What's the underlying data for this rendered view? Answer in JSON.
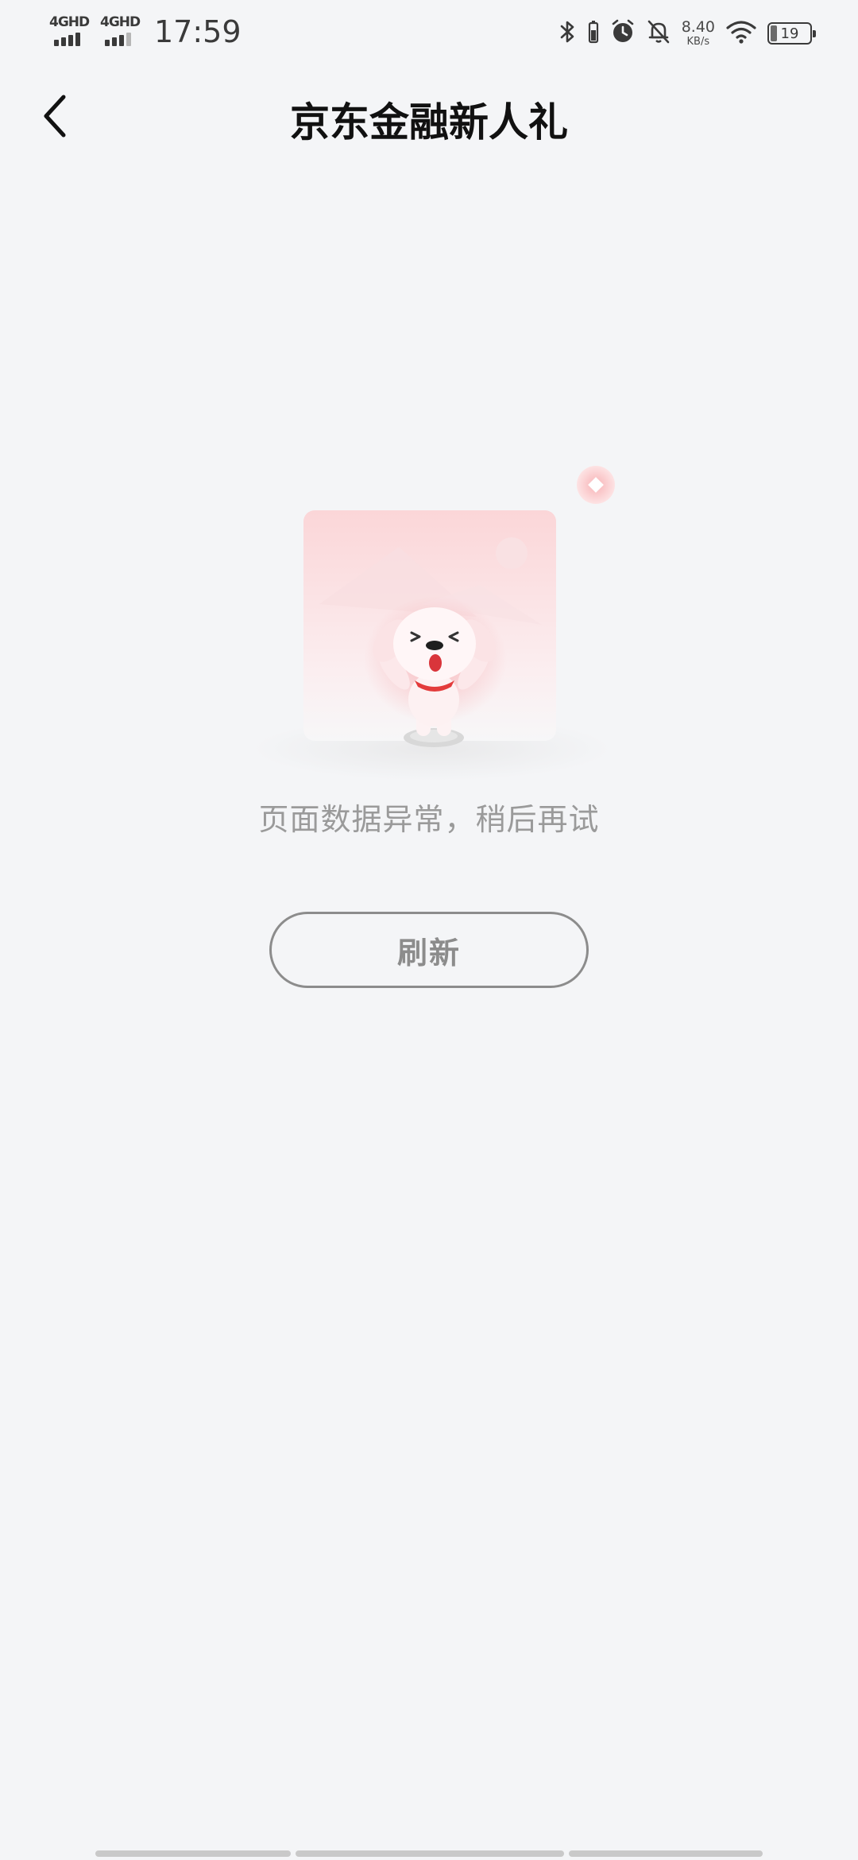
{
  "status_bar": {
    "network_1": "4GHD",
    "network_2": "4GHD",
    "time": "17:59",
    "speed_value": "8.40",
    "speed_unit": "KB/s",
    "battery_level": "19",
    "icons": [
      "bluetooth-icon",
      "battery-saver-icon",
      "alarm-icon",
      "mute-bell-icon",
      "wifi-icon"
    ]
  },
  "header": {
    "back_icon": "chevron-left-icon",
    "title": "京东金融新人礼"
  },
  "error_state": {
    "illustration": "jd-dog-mascot-illustration",
    "message": "页面数据异常，稍后再试",
    "refresh_label": "刷新"
  },
  "colors": {
    "background": "#f4f5f7",
    "title": "#111111",
    "muted_text": "#9a9a9a",
    "button_border": "#8c8c8c",
    "mascot_collar": "#e33b3b"
  }
}
